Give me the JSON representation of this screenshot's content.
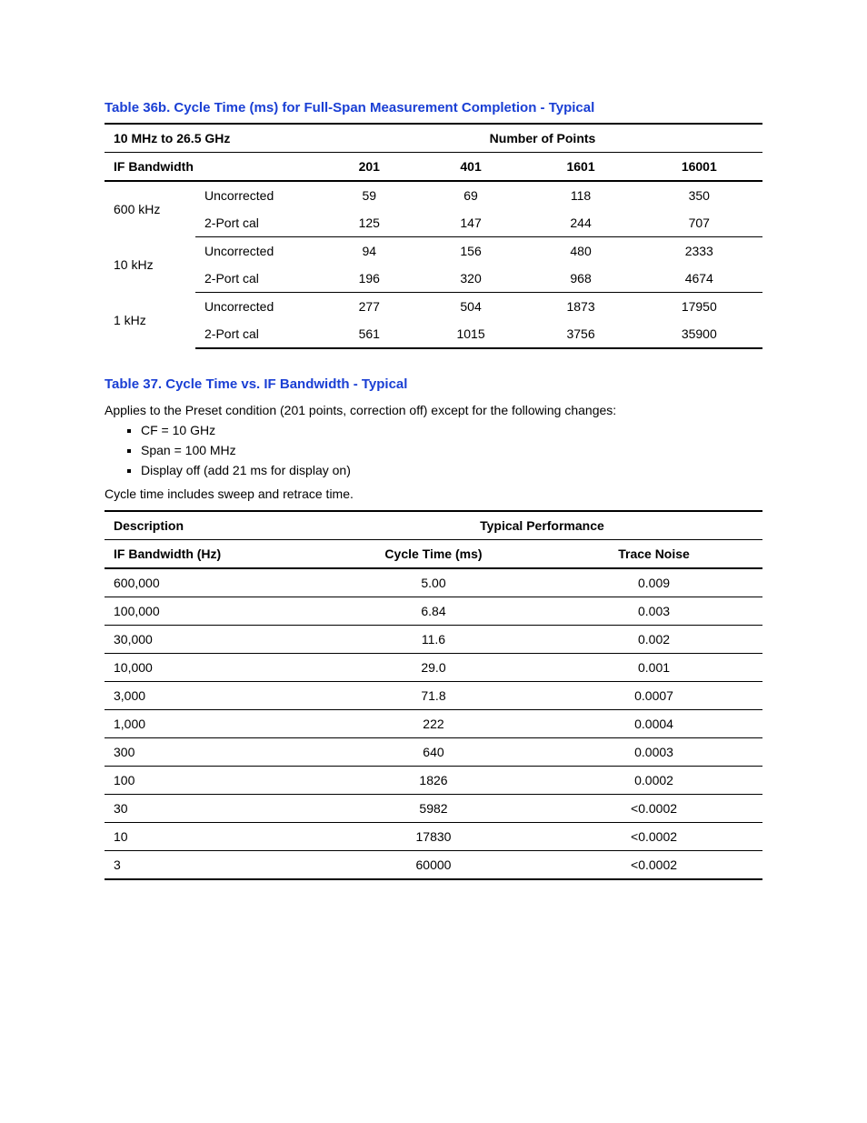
{
  "table36b": {
    "title": "Table 36b. Cycle Time (ms) for Full-Span Measurement Completion - Typical",
    "span_label": "10 MHz to 26.5 GHz",
    "points_label": "Number of Points",
    "bw_label": "IF Bandwidth",
    "points": [
      "201",
      "401",
      "1601",
      "16001"
    ],
    "groups": [
      {
        "bw": "600 kHz",
        "rows": [
          {
            "mode": "Uncorrected",
            "vals": [
              "59",
              "69",
              "118",
              "350"
            ]
          },
          {
            "mode": "2-Port cal",
            "vals": [
              "125",
              "147",
              "244",
              "707"
            ]
          }
        ]
      },
      {
        "bw": "10 kHz",
        "rows": [
          {
            "mode": "Uncorrected",
            "vals": [
              "94",
              "156",
              "480",
              "2333"
            ]
          },
          {
            "mode": "2-Port cal",
            "vals": [
              "196",
              "320",
              "968",
              "4674"
            ]
          }
        ]
      },
      {
        "bw": "1 kHz",
        "rows": [
          {
            "mode": "Uncorrected",
            "vals": [
              "277",
              "504",
              "1873",
              "17950"
            ]
          },
          {
            "mode": "2-Port cal",
            "vals": [
              "561",
              "1015",
              "3756",
              "35900"
            ]
          }
        ]
      }
    ]
  },
  "table37": {
    "title": "Table 37. Cycle Time vs. IF Bandwidth - Typical",
    "intro": "Applies to the Preset condition (201 points, correction off) except for the following changes:",
    "bullets": [
      "CF = 10 GHz",
      "Span = 100 MHz",
      "Display off (add 21 ms for display on)"
    ],
    "note": "Cycle time includes sweep and retrace time.",
    "hdr1_left": "Description",
    "hdr1_right": "Typical Performance",
    "hdr2": [
      "IF Bandwidth (Hz)",
      "Cycle Time (ms)",
      "Trace Noise"
    ],
    "rows": [
      {
        "bw": "600,000",
        "ct": "5.00",
        "tn": "0.009"
      },
      {
        "bw": "100,000",
        "ct": "6.84",
        "tn": "0.003"
      },
      {
        "bw": "30,000",
        "ct": "11.6",
        "tn": "0.002"
      },
      {
        "bw": "10,000",
        "ct": "29.0",
        "tn": "0.001"
      },
      {
        "bw": "3,000",
        "ct": "71.8",
        "tn": "0.0007"
      },
      {
        "bw": "1,000",
        "ct": "222",
        "tn": "0.0004"
      },
      {
        "bw": "300",
        "ct": "640",
        "tn": "0.0003"
      },
      {
        "bw": "100",
        "ct": "1826",
        "tn": "0.0002"
      },
      {
        "bw": "30",
        "ct": "5982",
        "tn": "<0.0002"
      },
      {
        "bw": "10",
        "ct": "17830",
        "tn": "<0.0002"
      },
      {
        "bw": "3",
        "ct": "60000",
        "tn": "<0.0002"
      }
    ]
  }
}
